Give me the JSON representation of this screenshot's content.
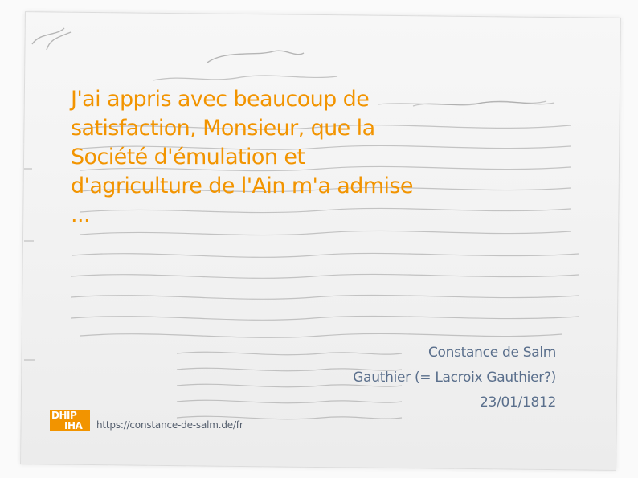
{
  "quote": {
    "lines": [
      " J'ai appris avec beaucoup de",
      "satisfaction, Monsieur, que la",
      "Société d'émulation et",
      "d'agriculture de l'Ain m'a admise",
      "..."
    ]
  },
  "meta": {
    "author": "Constance de Salm",
    "recipient": "Gauthier (= Lacroix Gauthier?)",
    "date": "23/01/1812"
  },
  "logo": {
    "line1": "DHIP",
    "line2": "IHA"
  },
  "url": "https://constance-de-salm.de/fr",
  "colors": {
    "quote": "#f29400",
    "meta": "#5a6f8c",
    "logo_bg": "#f29400"
  }
}
